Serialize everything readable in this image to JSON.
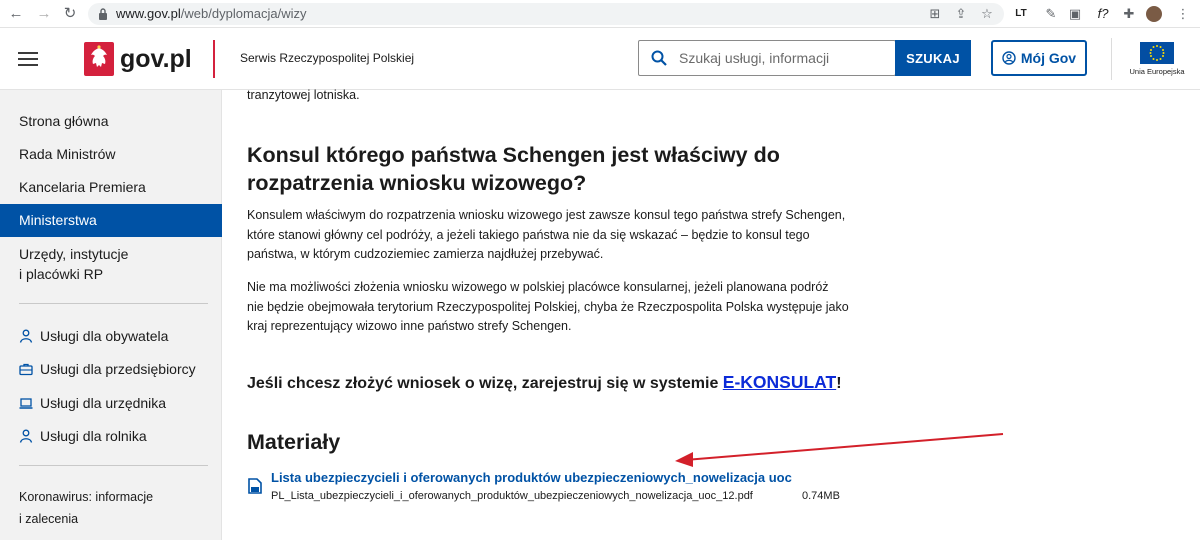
{
  "browser": {
    "url_domain": "www.gov.pl",
    "url_path": "/web/dyplomacja/wizy"
  },
  "header": {
    "logo_text": "gov.pl",
    "service_name": "Serwis Rzeczypospolitej Polskiej",
    "search_placeholder": "Szukaj usługi, informacji",
    "search_button": "SZUKAJ",
    "my_gov_button": "Mój Gov",
    "eu_label": "Unia Europejska"
  },
  "sidebar": {
    "nav": [
      {
        "label": "Strona główna"
      },
      {
        "label": "Rada Ministrów"
      },
      {
        "label": "Kancelaria Premiera"
      },
      {
        "label": "Ministerstwa"
      },
      {
        "label_line1": "Urzędy, instytucje",
        "label_line2": "i placówki RP"
      }
    ],
    "services": [
      {
        "label": "Usługi dla obywatela",
        "icon": "person-icon"
      },
      {
        "label": "Usługi dla przedsiębiorcy",
        "icon": "briefcase-icon"
      },
      {
        "label": "Usługi dla urzędnika",
        "icon": "laptop-icon"
      },
      {
        "label": "Usługi dla rolnika",
        "icon": "person-icon"
      }
    ],
    "footer_line1": "Koronawirus: informacje",
    "footer_line2": "i zalecenia"
  },
  "content": {
    "intro_tail": "tranzytowej lotniska.",
    "heading_line1": "Konsul którego państwa Schengen jest właściwy do",
    "heading_line2": "rozpatrzenia wniosku wizowego?",
    "para1": [
      "Konsulem właściwym do rozpatrzenia wniosku wizowego jest zawsze konsul tego państwa strefy Schengen,",
      "które stanowi główny cel podróży, a jeżeli takiego państwa nie da się wskazać – będzie to konsul tego",
      "państwa, w którym cudzoziemiec zamierza najdłużej przebywać."
    ],
    "para2": [
      "Nie ma możliwości złożenia wniosku wizowego w polskiej placówce konsularnej, jeżeli planowana podróż",
      "nie będzie obejmowała terytorium Rzeczypospolitej Polskiej, chyba że Rzeczpospolita Polska występuje jako",
      "kraj reprezentujący wizowo inne państwo strefy Schengen."
    ],
    "cta_text": "Jeśli chcesz złożyć wniosek o wizę, zarejestruj się w systemie ",
    "cta_link": "E-KONSULAT",
    "cta_end": "!",
    "materials_heading": "Materiały",
    "file_link": "Lista ubezpieczycieli i oferowanych produktów ubezpieczeniowych_nowelizacja uoc",
    "file_name": "PL_Lista_ubezpieczycieli_i_oferowanych_produktów_ubezpieczeniowych_nowelizacja_uoc_12.pdf",
    "file_size": "0.74MB"
  },
  "colors": {
    "brand_blue": "#0052a5",
    "brand_red": "#d4213d",
    "annotation_arrow": "#d3202a"
  }
}
